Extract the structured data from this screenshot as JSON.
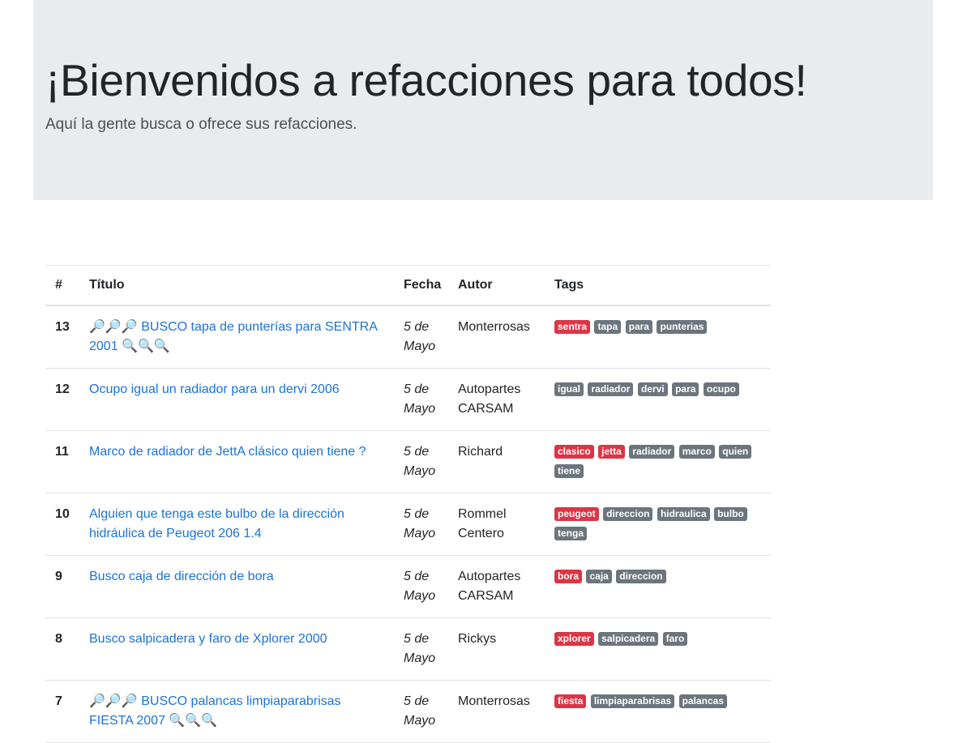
{
  "jumbotron": {
    "title": "¡Bienvenidos a refacciones para todos!",
    "lead": "Aquí la gente busca o ofrece sus refacciones."
  },
  "table": {
    "headers": {
      "num": "#",
      "title": "Título",
      "date": "Fecha",
      "author": "Autor",
      "tags": "Tags"
    },
    "rows": [
      {
        "num": "13",
        "title": "🔎🔎🔎 BUSCO tapa de punterías para SENTRA 2001 🔍🔍🔍",
        "date": "5 de Mayo",
        "author": "Monterrosas",
        "red_tags": [
          "sentra"
        ],
        "tags": [
          "tapa",
          "para",
          "punterias"
        ]
      },
      {
        "num": "12",
        "title": "Ocupo igual un radiador para un dervi 2006",
        "date": "5 de Mayo",
        "author": "Autopartes CARSAM",
        "red_tags": [],
        "tags": [
          "igual",
          "radiador",
          "dervi",
          "para",
          "ocupo"
        ]
      },
      {
        "num": "11",
        "title": "Marco de radiador de JettA clásico quien tiene ?",
        "date": "5 de Mayo",
        "author": "Richard",
        "red_tags": [
          "clasico",
          "jetta"
        ],
        "tags": [
          "radiador",
          "marco",
          "quien",
          "tiene"
        ]
      },
      {
        "num": "10",
        "title": "Alguien que tenga este bulbo de la dirección hidráulica de Peugeot 206 1.4",
        "date": "5 de Mayo",
        "author": "Rommel Centero",
        "red_tags": [
          "peugeot"
        ],
        "tags": [
          "direccion",
          "hidraulica",
          "bulbo",
          "tenga"
        ]
      },
      {
        "num": "9",
        "title": "Busco caja de dirección de bora",
        "date": "5 de Mayo",
        "author": "Autopartes CARSAM",
        "red_tags": [
          "bora"
        ],
        "tags": [
          "caja",
          "direccion"
        ]
      },
      {
        "num": "8",
        "title": "Busco salpicadera y faro de Xplorer 2000",
        "date": "5 de Mayo",
        "author": "Rickys",
        "red_tags": [
          "xplorer"
        ],
        "tags": [
          "salpicadera",
          "faro"
        ]
      },
      {
        "num": "7",
        "title": "🔎🔎🔎 BUSCO palancas limpiaparabrisas FIESTA 2007 🔍🔍🔍",
        "date": "5 de Mayo",
        "author": "Monterrosas",
        "red_tags": [
          "fiesta"
        ],
        "tags": [
          "limpiaparabrisas",
          "palancas"
        ]
      }
    ]
  },
  "colors": {
    "link": "#1a73d9",
    "badge_red": "#dc3545",
    "badge_gray": "#6c757d",
    "jumbotron_bg": "#e9ecef"
  }
}
